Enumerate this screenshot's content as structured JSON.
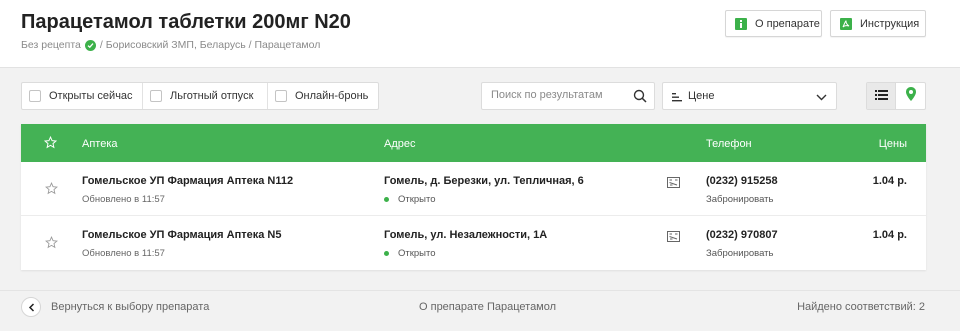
{
  "header": {
    "title": "Парацетамол таблетки 200мг N20",
    "breadcrumb": {
      "prescription": "Без рецепта",
      "rest": "/ Борисовский ЗМП, Беларусь / Парацетамол"
    },
    "about_button": "О препарате",
    "instruction_button": "Инструкция"
  },
  "filters": {
    "open_now": "Открыты сейчас",
    "preferential": "Льготный отпуск",
    "online_booking": "Онлайн-бронь"
  },
  "search": {
    "placeholder": "Поиск по результатам"
  },
  "sort": {
    "selected": "Цене"
  },
  "table": {
    "headers": {
      "pharmacy": "Аптека",
      "address": "Адрес",
      "phone": "Телефон",
      "price": "Цены"
    },
    "rows": [
      {
        "name": "Гомельское УП Фармация Аптека N112",
        "updated": "Обновлено в 11:57",
        "address": "Гомель, д. Березки, ул. Тепличная, 6",
        "status": "Открыто",
        "phone": "(0232) 915258",
        "reserve": "Забронировать",
        "price": "1.04 р."
      },
      {
        "name": "Гомельское УП Фармация Аптека N5",
        "updated": "Обновлено в 11:57",
        "address": "Гомель, ул. Незалежности, 1А",
        "status": "Открыто",
        "phone": "(0232) 970807",
        "reserve": "Забронировать",
        "price": "1.04 р."
      }
    ]
  },
  "footer": {
    "back": "Вернуться к выбору препарата",
    "about": "О препарате Парацетамол",
    "found": "Найдено соответствий:  2"
  },
  "colors": {
    "accent": "#44b255",
    "status_open": "#3cb14a"
  }
}
